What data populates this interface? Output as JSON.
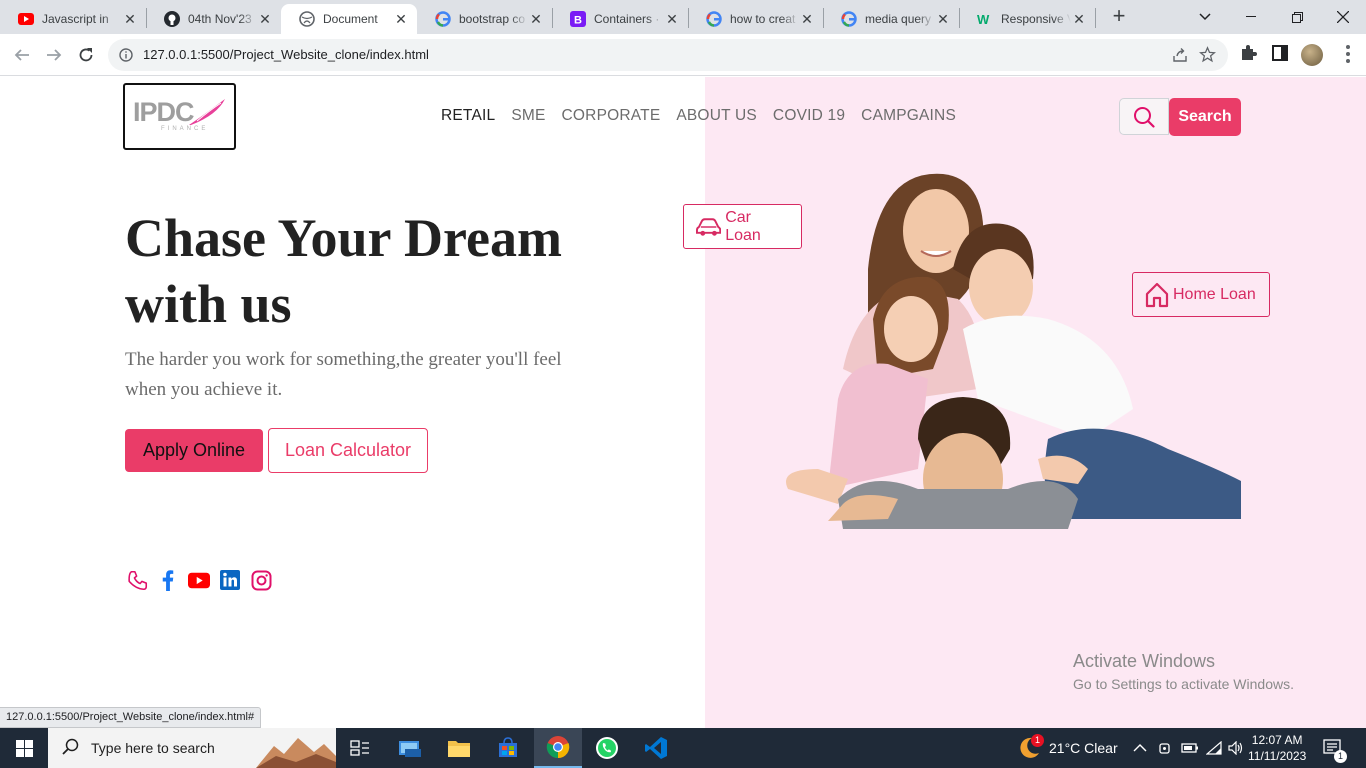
{
  "browser": {
    "tabs": [
      {
        "title": "Javascript in",
        "favicon": "youtube-icon"
      },
      {
        "title": "04th Nov'23",
        "favicon": "github-icon"
      },
      {
        "title": "Document",
        "favicon": "globe-icon",
        "active": true
      },
      {
        "title": "bootstrap co",
        "favicon": "google-icon"
      },
      {
        "title": "Containers ·",
        "favicon": "bootstrap-icon"
      },
      {
        "title": "how to creat",
        "favicon": "google-icon"
      },
      {
        "title": "media query",
        "favicon": "google-icon"
      },
      {
        "title": "Responsive V",
        "favicon": "w3schools-icon"
      }
    ],
    "new_tab": "+",
    "url": "127.0.0.1:5500/Project_Website_clone/index.html",
    "status_url": "127.0.0.1:5500/Project_Website_clone/index.html#"
  },
  "site": {
    "logo_text": "IPDC",
    "logo_sub": "FINANCE",
    "nav": [
      "RETAIL",
      "SME",
      "CORPORATE",
      "ABOUT US",
      "COVID 19",
      "CAMPGAINS"
    ],
    "search_label": "Search",
    "hero_title_line1": "Chase Your Dream",
    "hero_title_line2": "with us",
    "hero_sub": "The harder you work for something,the greater you'll feel when you achieve it.",
    "apply_label": "Apply Online",
    "calc_label": "Loan Calculator",
    "car_loan": "Car Loan",
    "home_loan": "Home Loan",
    "social": [
      "phone-icon",
      "facebook-icon",
      "youtube-icon",
      "linkedin-icon",
      "instagram-icon"
    ]
  },
  "watermark": {
    "line1": "Activate Windows",
    "line2": "Go to Settings to activate Windows."
  },
  "taskbar": {
    "search_placeholder": "Type here to search",
    "weather": "21°C  Clear",
    "weather_badge": "1",
    "time": "12:07 AM",
    "date": "11/11/2023",
    "notification_count": "1"
  },
  "colors": {
    "accent": "#ea3c68",
    "pink_panel": "#fde8f3"
  }
}
